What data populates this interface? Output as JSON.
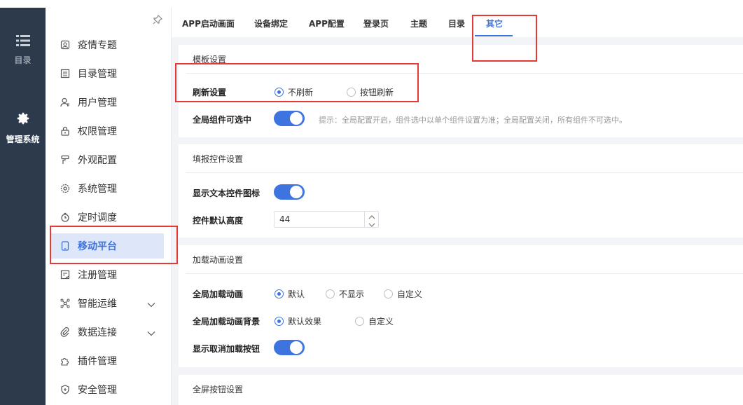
{
  "rail": {
    "items": [
      {
        "label": "目录",
        "icon": "list-icon"
      },
      {
        "label": "管理系统",
        "icon": "gear-icon",
        "active": true
      }
    ]
  },
  "sidebar": {
    "items": [
      {
        "label": "疫情专题",
        "icon": "topic-icon"
      },
      {
        "label": "目录管理",
        "icon": "catalog-icon"
      },
      {
        "label": "用户管理",
        "icon": "user-icon"
      },
      {
        "label": "权限管理",
        "icon": "lock-icon"
      },
      {
        "label": "外观配置",
        "icon": "brush-icon"
      },
      {
        "label": "系统管理",
        "icon": "settings-icon"
      },
      {
        "label": "定时调度",
        "icon": "timer-icon"
      },
      {
        "label": "移动平台",
        "icon": "mobile-icon",
        "active": true
      },
      {
        "label": "注册管理",
        "icon": "register-icon"
      },
      {
        "label": "智能运维",
        "icon": "network-icon",
        "expandable": true
      },
      {
        "label": "数据连接",
        "icon": "link-icon",
        "expandable": true
      },
      {
        "label": "插件管理",
        "icon": "plugin-icon"
      },
      {
        "label": "安全管理",
        "icon": "shield-icon"
      }
    ]
  },
  "tabs": [
    "APP启动画面",
    "设备绑定",
    "APP配置",
    "登录页",
    "主题",
    "目录",
    "其它"
  ],
  "active_tab": "其它",
  "template_settings": {
    "title": "模板设置",
    "refresh_label": "刷新设置",
    "refresh_options": [
      "不刷新",
      "按钮刷新"
    ],
    "refresh_selected": "不刷新",
    "global_select_label": "全局组件可选中",
    "global_select_on": true,
    "global_select_hint": "提示：全局配置开启，组件选中以单个组件设置为准；全局配置关闭，所有组件不可选中。"
  },
  "fill_settings": {
    "title": "填报控件设置",
    "show_icon_label": "显示文本控件图标",
    "show_icon_on": true,
    "height_label": "控件默认高度",
    "height_value": "44"
  },
  "loading_settings": {
    "title": "加载动画设置",
    "anim_label": "全局加载动画",
    "anim_options": [
      "默认",
      "不显示",
      "自定义"
    ],
    "anim_selected": "默认",
    "bg_label": "全局加载动画背景",
    "bg_options": [
      "默认效果",
      "自定义"
    ],
    "bg_selected": "默认效果",
    "cancel_label": "显示取消加载按钮",
    "cancel_on": true
  },
  "fullscreen_settings": {
    "title": "全屏按钮设置"
  },
  "colors": {
    "accent": "#3d74e0",
    "rail_bg": "#2d3a4b",
    "annotation": "#e53935"
  }
}
